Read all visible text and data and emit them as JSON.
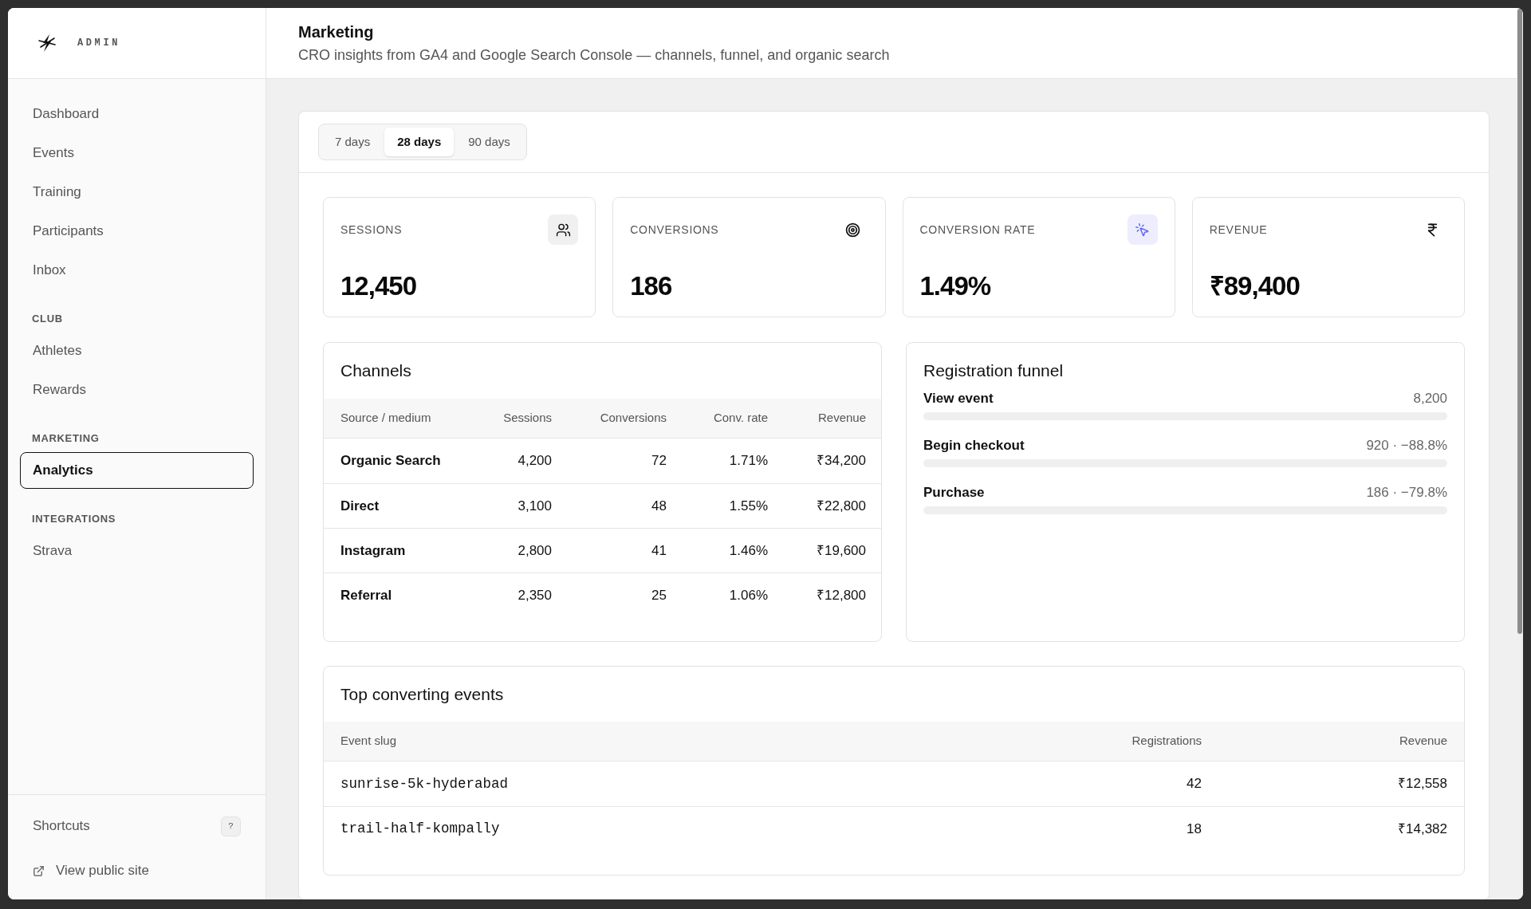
{
  "sidebar": {
    "brand": {
      "label": "ADMIN"
    },
    "sections": [
      {
        "items": [
          {
            "label": "Dashboard",
            "selected": false
          },
          {
            "label": "Events",
            "selected": false
          },
          {
            "label": "Training",
            "selected": false
          },
          {
            "label": "Participants",
            "selected": false
          },
          {
            "label": "Inbox",
            "selected": false
          }
        ]
      },
      {
        "heading": "CLUB",
        "items": [
          {
            "label": "Athletes",
            "selected": false
          },
          {
            "label": "Rewards",
            "selected": false
          }
        ]
      },
      {
        "heading": "MARKETING",
        "items": [
          {
            "label": "Analytics",
            "selected": true
          }
        ]
      },
      {
        "heading": "INTEGRATIONS",
        "items": [
          {
            "label": "Strava",
            "selected": false
          }
        ]
      }
    ],
    "footer": {
      "shortcuts": {
        "label": "Shortcuts",
        "key": "?"
      },
      "public_site_link": {
        "label": "View public site"
      }
    }
  },
  "header": {
    "title": "Marketing",
    "subtitle": "CRO insights from GA4 and Google Search Console — channels, funnel, and organic search"
  },
  "range_tabs": [
    {
      "label": "7 days",
      "selected": false
    },
    {
      "label": "28 days",
      "selected": true
    },
    {
      "label": "90 days",
      "selected": false
    }
  ],
  "kpis": [
    {
      "label": "SESSIONS",
      "value": "12,450",
      "icon_tile": true,
      "accent": false
    },
    {
      "label": "CONVERSIONS",
      "value": "186",
      "icon_tile": false,
      "accent": false
    },
    {
      "label": "CONVERSION RATE",
      "value": "1.49%",
      "icon_tile": true,
      "accent": true
    },
    {
      "label": "REVENUE",
      "value": "₹89,400",
      "icon_tile": false,
      "accent": false
    }
  ],
  "channels": {
    "title": "Channels",
    "columns": [
      "Source / medium",
      "Sessions",
      "Conversions",
      "Conv. rate",
      "Revenue"
    ],
    "rows": [
      [
        "Organic Search",
        "4,200",
        "72",
        "1.71%",
        "₹34,200"
      ],
      [
        "Direct",
        "3,100",
        "48",
        "1.55%",
        "₹22,800"
      ],
      [
        "Instagram",
        "2,800",
        "41",
        "1.46%",
        "₹19,600"
      ],
      [
        "Referral",
        "2,350",
        "25",
        "1.06%",
        "₹12,800"
      ]
    ]
  },
  "funnel": {
    "title": "Registration funnel",
    "steps": [
      {
        "label": "View event",
        "reading": "8,200"
      },
      {
        "label": "Begin checkout",
        "reading": "920 · −88.8%"
      },
      {
        "label": "Purchase",
        "reading": "186 · −79.8%"
      }
    ]
  },
  "top_events": {
    "title": "Top converting events",
    "columns": [
      "Event slug",
      "Registrations",
      "Revenue"
    ],
    "rows": [
      [
        "sunrise-5k-hyderabad",
        "42",
        "₹12,558"
      ],
      [
        "trail-half-kompally",
        "18",
        "₹14,382"
      ]
    ]
  }
}
